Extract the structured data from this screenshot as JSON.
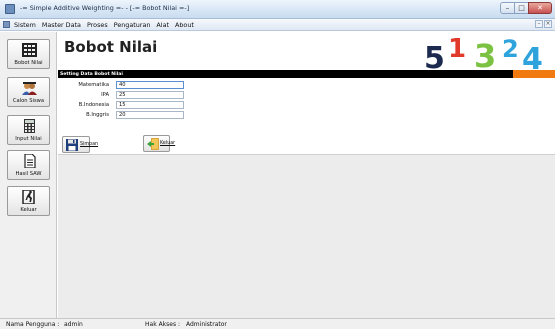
{
  "window": {
    "title": "-= Simple Additive Weighting =- - [-= Bobot Nilai =-]"
  },
  "menu": {
    "items": [
      "Sistem",
      "Master Data",
      "Proses",
      "Pengaturan",
      "Alat",
      "About"
    ]
  },
  "sidebar": {
    "items": [
      {
        "label": "Bobot Nilai",
        "icon": "grid-icon"
      },
      {
        "label": "Calon Siswa",
        "icon": "students-icon"
      },
      {
        "label": "Input Nilai",
        "icon": "calculator-icon"
      },
      {
        "label": "Hasil SAW",
        "icon": "document-icon"
      },
      {
        "label": "Keluar",
        "icon": "exit-door-icon"
      }
    ]
  },
  "page": {
    "title": "Bobot Nilai",
    "section_title": "Setting Data Bobot Nilai"
  },
  "form": {
    "fields": [
      {
        "label": "Matematika",
        "value": "40"
      },
      {
        "label": "IPA",
        "value": "25"
      },
      {
        "label": "B.Indonesia",
        "value": "15"
      },
      {
        "label": "B.Inggris",
        "value": "20"
      }
    ],
    "save_label": "Simpan",
    "exit_label": "Keluar"
  },
  "status": {
    "user_label": "Nama Pengguna :",
    "user_value": "admin",
    "access_label": "Hak Akses :",
    "access_value": "Administrator"
  },
  "colors": {
    "logo_red": "#e03a2a",
    "logo_green": "#7cc242",
    "logo_blue": "#2ea3dc",
    "logo_navy": "#1c2a50",
    "accent_orange": "#f07a10"
  }
}
